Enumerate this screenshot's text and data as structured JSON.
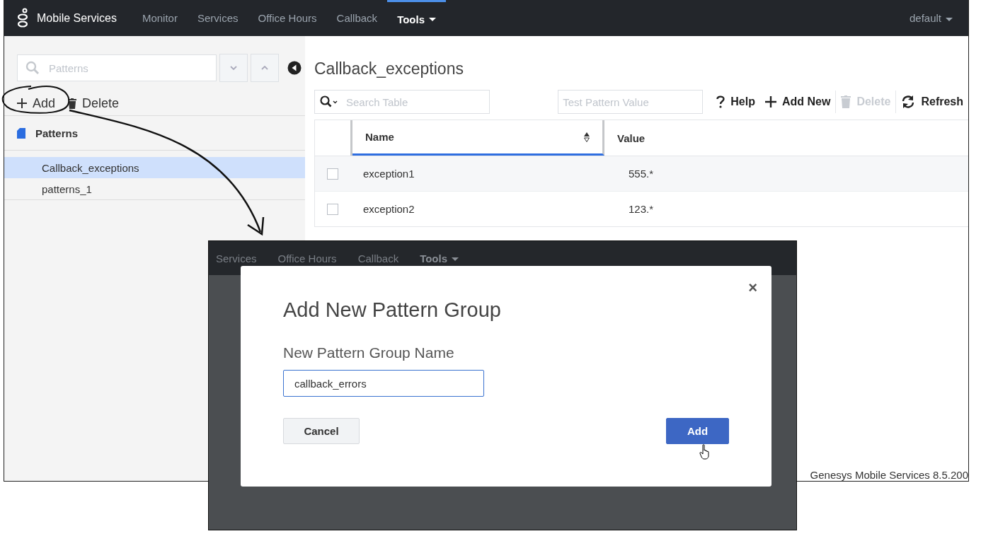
{
  "nav": {
    "brand": "Mobile Services",
    "items": [
      {
        "label": "Monitor",
        "selected": false,
        "dropdown": false
      },
      {
        "label": "Services",
        "selected": false,
        "dropdown": false
      },
      {
        "label": "Office Hours",
        "selected": false,
        "dropdown": false
      },
      {
        "label": "Callback",
        "selected": false,
        "dropdown": false
      },
      {
        "label": "Tools",
        "selected": true,
        "dropdown": true
      }
    ],
    "profile": "default"
  },
  "sidebar": {
    "search": {
      "placeholder": "Patterns"
    },
    "actions": [
      {
        "label": "Add",
        "kind": "add"
      },
      {
        "label": "Delete",
        "kind": "delete"
      }
    ],
    "section": "Patterns",
    "items": [
      {
        "label": "Callback_exceptions",
        "selected": true
      },
      {
        "label": "patterns_1",
        "selected": false
      }
    ]
  },
  "content": {
    "title": "Callback_exceptions",
    "search": {
      "placeholder": "Search Table"
    },
    "test_field": {
      "placeholder": "Test Pattern Value"
    },
    "toolbar": [
      {
        "label": "Help",
        "kind": "help",
        "disabled": false
      },
      {
        "label": "Add New",
        "kind": "add",
        "disabled": false
      },
      {
        "label": "Delete",
        "kind": "delete",
        "disabled": true
      },
      {
        "label": "Refresh",
        "kind": "refresh",
        "disabled": false
      }
    ],
    "table": {
      "columns": [
        {
          "label": "Name",
          "sorted": true
        },
        {
          "label": "Value",
          "sorted": false
        }
      ],
      "rows": [
        {
          "name": "exception1",
          "value": "555.*",
          "checked": false
        },
        {
          "name": "exception2",
          "value": "123.*",
          "checked": false
        }
      ]
    }
  },
  "footer": "Genesys Mobile Services 8.5.200",
  "background_nav": [
    {
      "label": "Services",
      "selected": false
    },
    {
      "label": "Office Hours",
      "selected": false
    },
    {
      "label": "Callback",
      "selected": false
    },
    {
      "label": "Tools",
      "selected": true
    }
  ],
  "dialog": {
    "title": "Add New Pattern Group",
    "close": "×",
    "field_label": "New Pattern Group Name",
    "value": "callback_errors",
    "buttons": [
      {
        "label": "Cancel",
        "kind": "secondary"
      },
      {
        "label": "Add",
        "kind": "primary"
      }
    ]
  }
}
